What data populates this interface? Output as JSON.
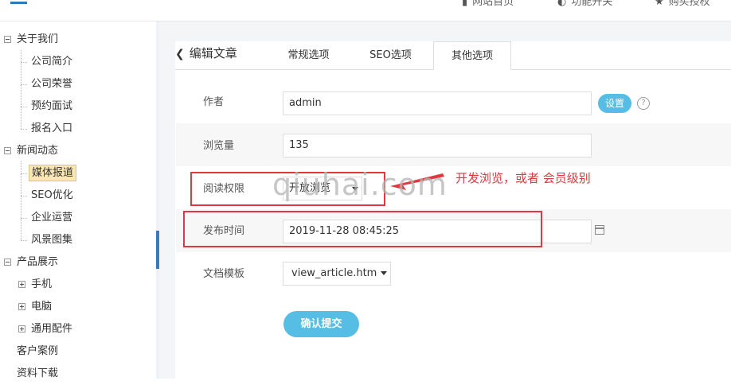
{
  "header": {
    "nav": [
      {
        "icon": "home-icon",
        "label": "网站首页"
      },
      {
        "icon": "toggle-icon",
        "label": "功能开关"
      },
      {
        "icon": "star-icon",
        "label": "购买授权"
      }
    ]
  },
  "sidebar": {
    "groups": [
      {
        "label": "关于我们",
        "children": [
          "公司简介",
          "公司荣誉",
          "预约面试",
          "报名入口"
        ]
      },
      {
        "label": "新闻动态",
        "children": [
          "媒体报道",
          "SEO优化",
          "企业运营",
          "风景图集"
        ],
        "active": "媒体报道"
      },
      {
        "label": "产品展示",
        "children": [
          "手机",
          "电脑",
          "通用配件"
        ]
      },
      {
        "label": "客户案例"
      },
      {
        "label": "资料下载"
      }
    ]
  },
  "page": {
    "back_label": "编辑文章",
    "tabs": [
      "常规选项",
      "SEO选项",
      "其他选项"
    ],
    "active_tab": "其他选项"
  },
  "form": {
    "author": {
      "label": "作者",
      "value": "admin",
      "button": "设置",
      "help": "?"
    },
    "views": {
      "label": "浏览量",
      "value": "135"
    },
    "permission": {
      "label": "阅读权限",
      "value": "开放浏览"
    },
    "publish_time": {
      "label": "发布时间",
      "value": "2019-11-28 08:45:25"
    },
    "template": {
      "label": "文档模板",
      "value": "view_article.htm"
    },
    "submit_label": "确认提交"
  },
  "annotation": {
    "note": "开发浏览，或者 会员级别",
    "watermark": "qiuhai.com",
    "color": "#e0383e"
  }
}
